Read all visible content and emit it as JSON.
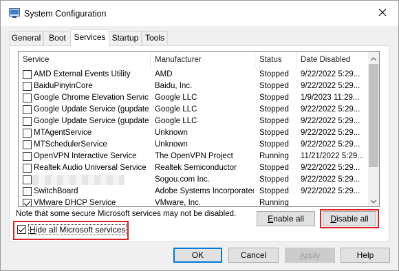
{
  "window": {
    "title": "System Configuration",
    "app_icon": "system-config-icon",
    "close_icon": "close-icon"
  },
  "tabs": [
    {
      "label": "General",
      "active": false
    },
    {
      "label": "Boot",
      "active": false
    },
    {
      "label": "Services",
      "active": true
    },
    {
      "label": "Startup",
      "active": false
    },
    {
      "label": "Tools",
      "active": false
    }
  ],
  "list": {
    "columns": [
      "Service",
      "Manufacturer",
      "Status",
      "Date Disabled"
    ],
    "rows": [
      {
        "checked": false,
        "service": "AMD External Events Utility",
        "manufacturer": "AMD",
        "status": "Stopped",
        "date": "9/22/2022 5:29..."
      },
      {
        "checked": false,
        "service": "BaiduPinyinCore",
        "manufacturer": "Baidu, Inc.",
        "status": "Stopped",
        "date": "9/22/2022 5:29..."
      },
      {
        "checked": false,
        "service": "Google Chrome Elevation Servic...",
        "manufacturer": "Google LLC",
        "status": "Stopped",
        "date": "1/9/2023 11:29..."
      },
      {
        "checked": false,
        "service": "Google Update Service (gupdate)",
        "manufacturer": "Google LLC",
        "status": "Stopped",
        "date": "9/22/2022 5:29..."
      },
      {
        "checked": false,
        "service": "Google Update Service (gupdatem)",
        "manufacturer": "Google LLC",
        "status": "Stopped",
        "date": "9/22/2022 5:29..."
      },
      {
        "checked": false,
        "service": "MTAgentService",
        "manufacturer": "Unknown",
        "status": "Stopped",
        "date": "9/22/2022 5:29..."
      },
      {
        "checked": false,
        "service": "MTSchedulerService",
        "manufacturer": "Unknown",
        "status": "Stopped",
        "date": "9/22/2022 5:29..."
      },
      {
        "checked": false,
        "service": "OpenVPN Interactive Service",
        "manufacturer": "The OpenVPN Project",
        "status": "Running",
        "date": "11/21/2022 5:29..."
      },
      {
        "checked": false,
        "service": "Realtek Audio Universal Service",
        "manufacturer": "Realtek Semiconductor",
        "status": "Stopped",
        "date": "9/22/2022 5:29..."
      },
      {
        "checked": false,
        "service": "",
        "manufacturer": "Sogou.com Inc.",
        "status": "Stopped",
        "date": "9/22/2022 5:29...",
        "blurred": true
      },
      {
        "checked": false,
        "service": "SwitchBoard",
        "manufacturer": "Adobe Systems Incorporated",
        "status": "Stopped",
        "date": "9/22/2022 5:29..."
      },
      {
        "checked": true,
        "service": "VMware DHCP Service",
        "manufacturer": "VMware, Inc.",
        "status": "Running",
        "date": ""
      }
    ]
  },
  "note": "Note that some secure Microsoft services may not be disabled.",
  "buttons": {
    "enable_all": {
      "label": "nable all",
      "mnemonic": "E"
    },
    "disable_all": {
      "label": "isable all",
      "mnemonic": "D"
    },
    "ok": "OK",
    "cancel": "Cancel",
    "apply": {
      "label": "pply",
      "mnemonic": "A"
    },
    "help": "Help"
  },
  "hide_ms": {
    "label": "ide all Microsoft services",
    "mnemonic": "H",
    "checked": true
  },
  "colors": {
    "highlight": "#e02020",
    "default_button_border": "#0078d7"
  }
}
